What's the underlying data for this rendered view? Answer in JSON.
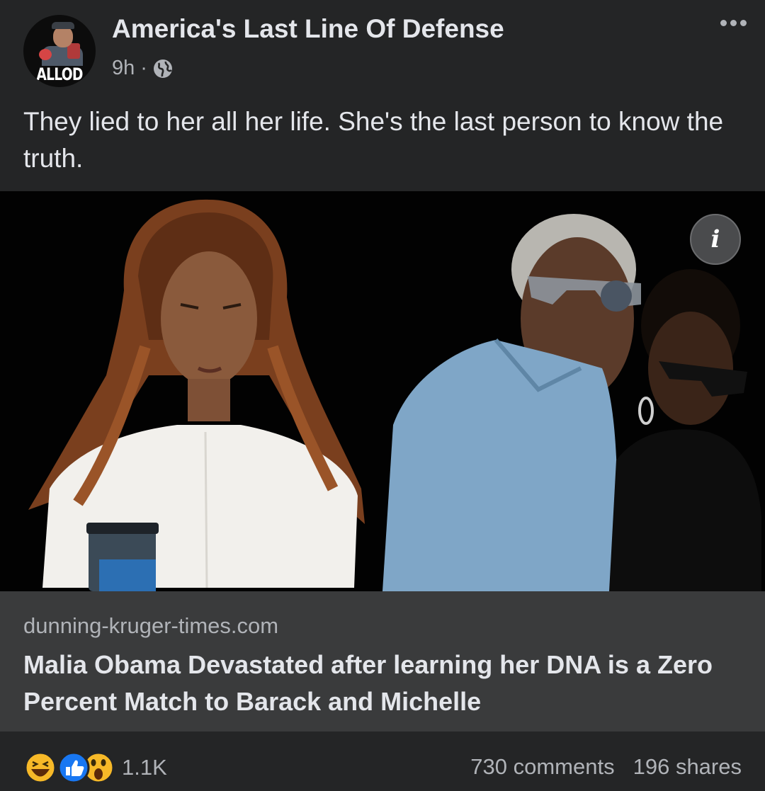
{
  "post": {
    "page_name": "America's Last Line Of Defense",
    "avatar_logo_text": "ALLOD",
    "time": "9h",
    "separator": "·",
    "audience_icon": "globe-icon",
    "more_icon": "more-dots-icon",
    "caption": "They lied to her all her life. She's the last person to know the truth."
  },
  "image": {
    "info_icon": "info-icon",
    "info_label": "i"
  },
  "link": {
    "domain": "dunning-kruger-times.com",
    "headline": "Malia Obama Devastated after learning her DNA is a Zero Percent Match to Barack and Michelle"
  },
  "footer": {
    "reaction_icons": [
      "haha-icon",
      "like-icon",
      "wow-icon"
    ],
    "reaction_count": "1.1K",
    "comments": "730 comments",
    "shares": "196 shares"
  },
  "colors": {
    "background": "#242526",
    "link_box": "#3a3b3c",
    "primary_text": "#e4e6eb",
    "secondary_text": "#b0b3b8",
    "like_blue": "#1877f2",
    "reaction_yellow": "#f7b928"
  }
}
